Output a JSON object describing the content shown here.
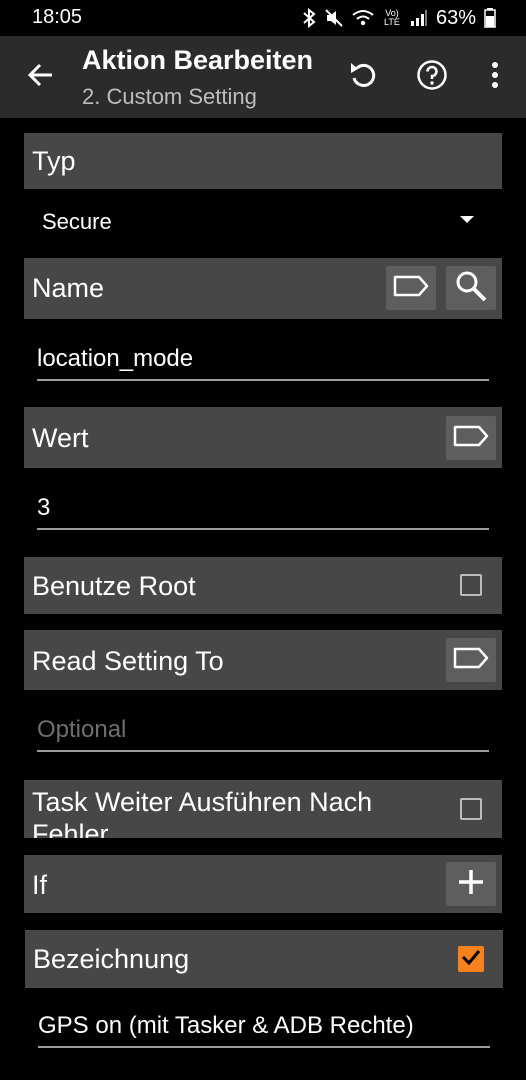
{
  "status_bar": {
    "time": "18:05",
    "battery": "63%",
    "icons": [
      "bluetooth-icon",
      "mute-icon",
      "wifi-icon",
      "volte-icon",
      "signal-icon",
      "battery-icon"
    ],
    "volte_label": "Vo) LTE"
  },
  "app_bar": {
    "title": "Aktion Bearbeiten",
    "subtitle": "2. Custom Setting",
    "icons": [
      "back-arrow-icon",
      "undo-icon",
      "help-icon",
      "more-vert-icon"
    ]
  },
  "sections": {
    "typ": {
      "label": "Typ",
      "value": "Secure"
    },
    "name": {
      "label": "Name",
      "value": "location_mode",
      "icons": [
        "tag-icon",
        "search-icon"
      ]
    },
    "wert": {
      "label": "Wert",
      "value": "3",
      "icons": [
        "tag-icon"
      ]
    },
    "root": {
      "label": "Benutze Root",
      "checked": false
    },
    "read_setting": {
      "label": "Read Setting To",
      "placeholder": "Optional",
      "icons": [
        "tag-icon"
      ]
    },
    "continue": {
      "label": "Task Weiter Ausführen Nach Fehler",
      "checked": false
    },
    "if": {
      "label": "If",
      "icons": [
        "plus-icon"
      ]
    },
    "label": {
      "label": "Bezeichnung",
      "checked": true,
      "value": "GPS on (mit Tasker & ADB Rechte)"
    }
  },
  "colors": {
    "background": "#000000",
    "app_bar": "#2b2b2b",
    "section": "#474747",
    "button": "#5e5e5e",
    "accent": "#f5821f"
  }
}
